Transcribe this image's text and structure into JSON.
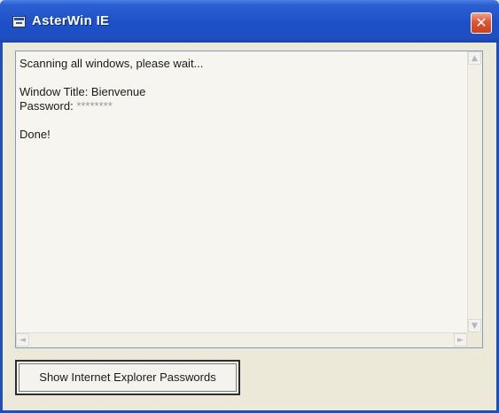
{
  "window": {
    "title": "AsterWin IE",
    "close_glyph": "✕",
    "title_icon": "app-window-icon",
    "colors": {
      "titlebar": "#1d50c8",
      "close": "#e0542e",
      "face": "#ece9d8"
    }
  },
  "output": {
    "lines": [
      "Scanning all windows, please wait...",
      "",
      "Window Title: Bienvenue",
      "Password: ",
      "",
      "Done!"
    ],
    "password_value": "********"
  },
  "scrollbars": {
    "up_glyph": "▲",
    "down_glyph": "▼",
    "left_glyph": "◄",
    "right_glyph": "►"
  },
  "actions": {
    "show_ie_passwords_label": "Show Internet Explorer Passwords"
  }
}
